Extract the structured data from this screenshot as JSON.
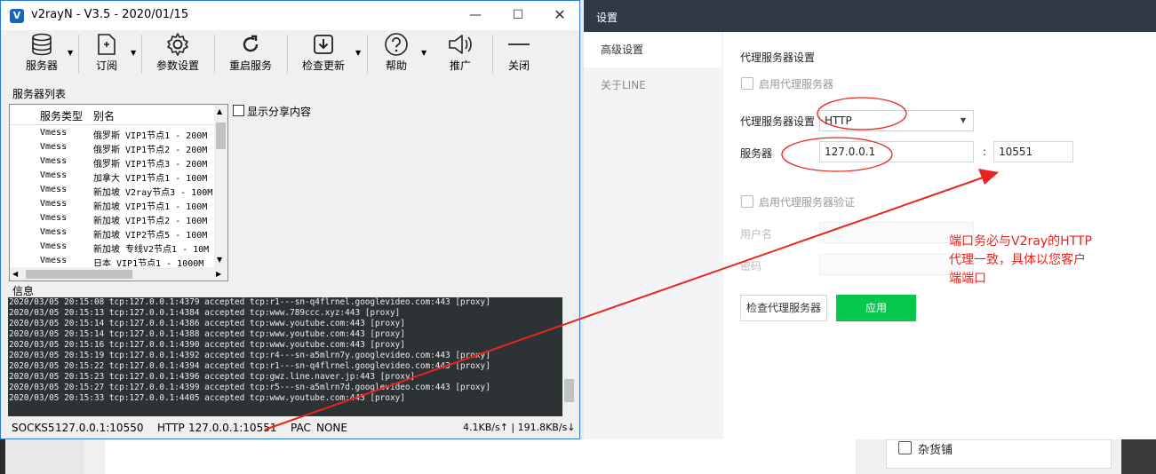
{
  "background": {
    "checkbox_label": "杂货铺"
  },
  "v2rayn": {
    "title": "v2rayN - V3.5 - 2020/01/15",
    "logo": "V",
    "toolbar": {
      "servers": "服务器",
      "subscribe": "订阅",
      "params": "参数设置",
      "restart": "重启服务",
      "update": "检查更新",
      "help": "帮助",
      "promote": "推广",
      "close": "关闭"
    },
    "server_list_label": "服务器列表",
    "columns": {
      "type": "服务类型",
      "alias": "别名"
    },
    "rows": [
      {
        "type": "Vmess",
        "name": "俄罗斯 VIP1节点1 - 200M"
      },
      {
        "type": "Vmess",
        "name": "俄罗斯 VIP1节点2 - 200M"
      },
      {
        "type": "Vmess",
        "name": "俄罗斯 VIP1节点3 - 200M"
      },
      {
        "type": "Vmess",
        "name": "加拿大 VIP1节点1 - 100M"
      },
      {
        "type": "Vmess",
        "name": "新加坡 V2ray节点3 - 100M"
      },
      {
        "type": "Vmess",
        "name": "新加坡 VIP1节点1 - 100M"
      },
      {
        "type": "Vmess",
        "name": "新加坡 VIP1节点2 - 100M"
      },
      {
        "type": "Vmess",
        "name": "新加坡 VIP2节点5 - 100M"
      },
      {
        "type": "Vmess",
        "name": "新加坡 专线V2节点1 - 10M"
      },
      {
        "type": "Vmess",
        "name": "日本 VIP1节点1 - 1000M"
      }
    ],
    "show_share_label": "显示分享内容",
    "info_label": "信息",
    "log": [
      "2020/03/05 20:15:08 tcp:127.0.0.1:4379 accepted tcp:r1---sn-q4flrnel.googlevideo.com:443 [proxy]",
      "2020/03/05 20:15:13 tcp:127.0.0.1:4384 accepted tcp:www.789ccc.xyz:443 [proxy]",
      "2020/03/05 20:15:14 tcp:127.0.0.1:4386 accepted tcp:www.youtube.com:443 [proxy]",
      "2020/03/05 20:15:14 tcp:127.0.0.1:4388 accepted tcp:www.youtube.com:443 [proxy]",
      "2020/03/05 20:15:16 tcp:127.0.0.1:4390 accepted tcp:www.youtube.com:443 [proxy]",
      "2020/03/05 20:15:19 tcp:127.0.0.1:4392 accepted tcp:r4---sn-a5mlrn7y.googlevideo.com:443 [proxy]",
      "2020/03/05 20:15:22 tcp:127.0.0.1:4394 accepted tcp:r1---sn-q4flrnel.googlevideo.com:443 [proxy]",
      "2020/03/05 20:15:23 tcp:127.0.0.1:4396 accepted tcp:gwz.line.naver.jp:443 [proxy]",
      "2020/03/05 20:15:27 tcp:127.0.0.1:4399 accepted tcp:r5---sn-a5mlrn7d.googlevideo.com:443 [proxy]",
      "2020/03/05 20:15:33 tcp:127.0.0.1:4405 accepted tcp:www.youtube.com:443 [proxy]"
    ],
    "status": {
      "socks_label": "SOCKS5",
      "socks_value": "127.0.0.1:10550",
      "http_label": "HTTP",
      "http_value": "127.0.0.1:10551",
      "pac_label": "PAC",
      "pac_value": "NONE",
      "speed": "4.1KB/s↑ | 191.8KB/s↓"
    }
  },
  "settings": {
    "title": "设置",
    "nav": {
      "advanced": "高级设置",
      "about": "关于LINE"
    },
    "heading": "代理服务器设置",
    "enable_proxy": "启用代理服务器",
    "proxy_type_label": "代理服务器设置",
    "proxy_type_value": "HTTP",
    "server_label": "服务器",
    "server_value": "127.0.0.1",
    "colon": ":",
    "port_value": "10551",
    "enable_auth": "启用代理服务器验证",
    "username_label": "用户名",
    "password_label": "密码",
    "check_button": "检查代理服务器",
    "apply_button": "应用"
  },
  "annotation": "端口务必与V2ray的HTTP代理一致，具体以您客户端端口",
  "colors": {
    "annotation": "#e8251f",
    "apply_green": "#08c74d",
    "settings_titlebar": "#303a47",
    "log_bg": "#2d3235"
  }
}
